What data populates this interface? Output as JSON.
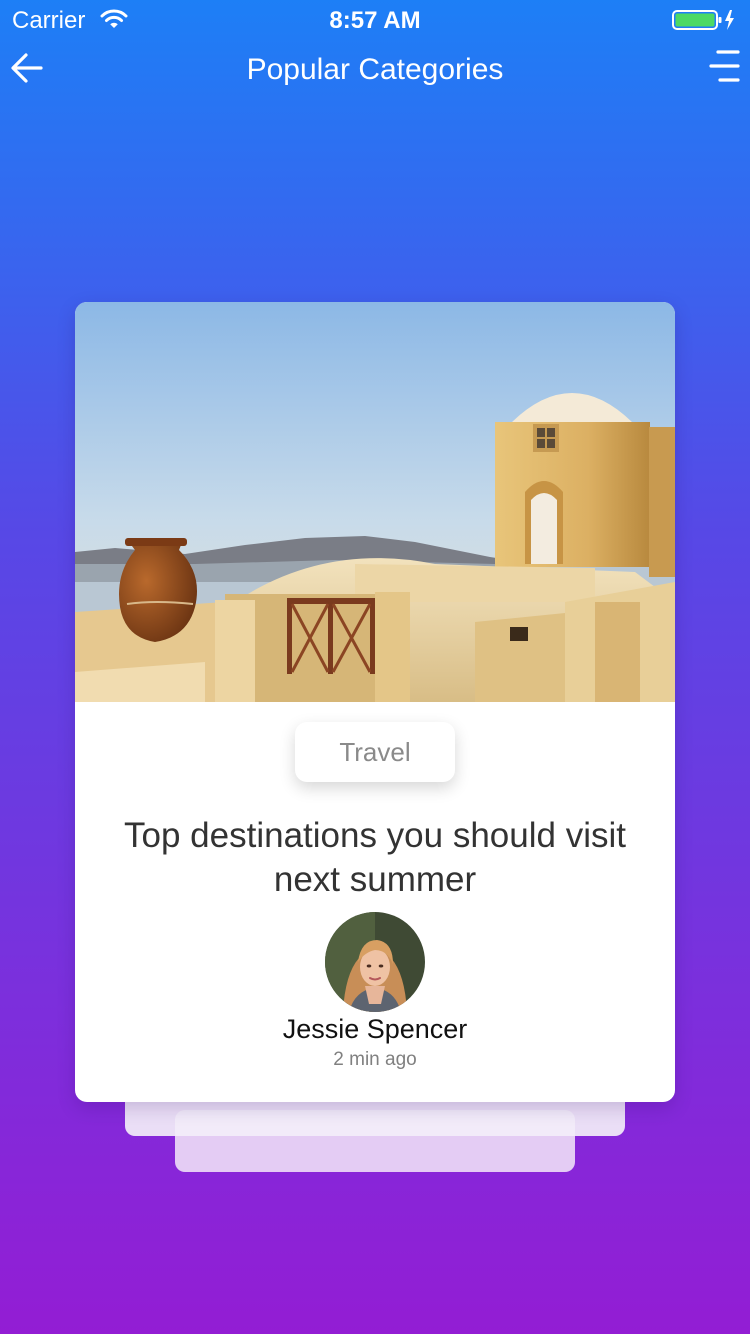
{
  "status_bar": {
    "carrier": "Carrier",
    "time": "8:57 AM",
    "wifi_icon": "wifi-icon",
    "battery_icon": "battery-charging-icon"
  },
  "nav": {
    "title": "Popular Categories",
    "back_icon": "arrow-left-icon",
    "menu_icon": "menu-icon"
  },
  "card": {
    "image": "santorini-rooftop-photo",
    "category": "Travel",
    "headline": "Top destinations you should visit next summer",
    "author": {
      "name": "Jessie Spencer",
      "avatar": "author-avatar-photo",
      "time_ago": "2 min ago"
    }
  },
  "colors": {
    "gradient_top": "#1d7ff6",
    "gradient_bottom": "#931dd4",
    "card_background": "#ffffff"
  }
}
